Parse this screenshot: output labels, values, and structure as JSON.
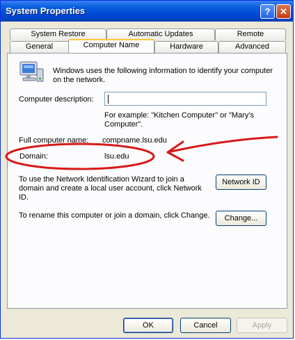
{
  "window": {
    "title": "System Properties"
  },
  "titlebar": {
    "help_glyph": "?",
    "close_glyph": "✕"
  },
  "tabs": {
    "row1": [
      "System Restore",
      "Automatic Updates",
      "Remote"
    ],
    "row2": [
      "General",
      "Computer Name",
      "Hardware",
      "Advanced"
    ]
  },
  "panel": {
    "intro": "Windows uses the following information to identify your computer on the network.",
    "description_label": "Computer description:",
    "description_value": "",
    "example": "For example: \"Kitchen Computer\" or \"Mary's Computer\".",
    "full_name_label": "Full computer name:",
    "full_name_value": "compname.lsu.edu",
    "domain_label": "Domain:",
    "domain_value": "lsu.edu",
    "wizard_text": "To use the Network Identification Wizard to join a domain and create a local user account, click Network ID.",
    "network_id_button": "Network ID",
    "rename_text": "To rename this computer or join a domain, click Change.",
    "change_button": "Change..."
  },
  "footer": {
    "ok": "OK",
    "cancel": "Cancel",
    "apply": "Apply"
  },
  "annotation": {
    "color": "#d81818"
  }
}
